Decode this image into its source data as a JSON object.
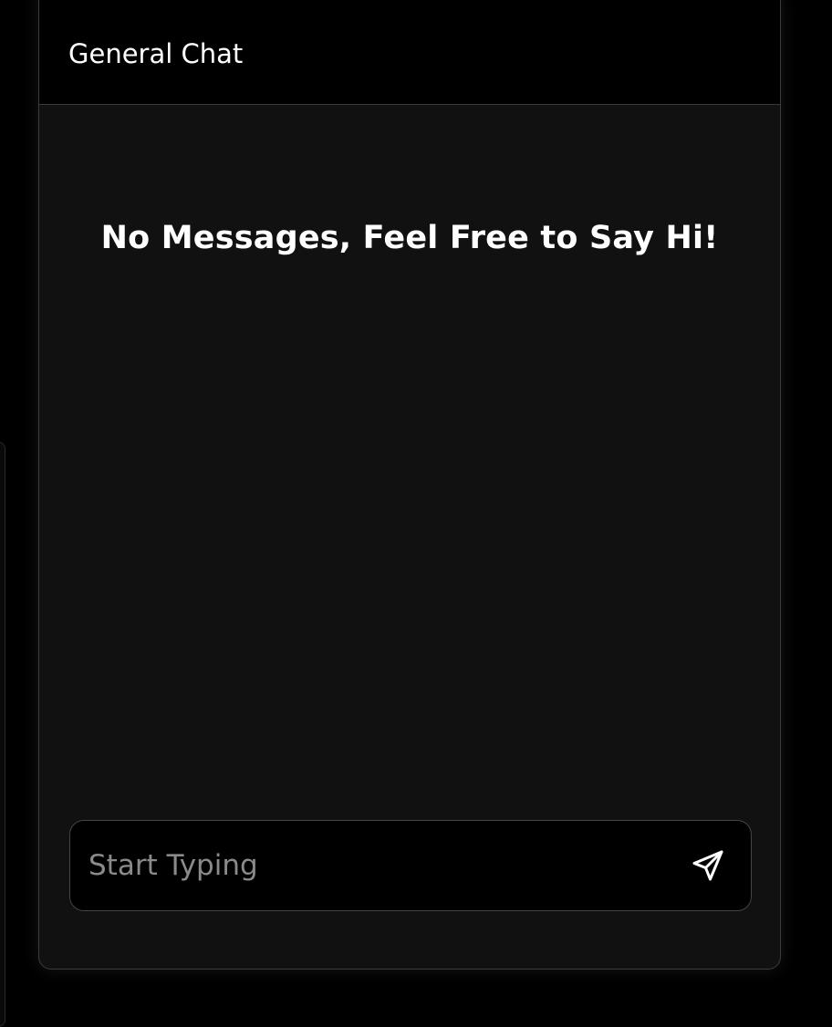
{
  "chat": {
    "title": "General Chat",
    "empty_state": "No Messages, Feel Free to Say Hi!"
  },
  "composer": {
    "placeholder": "Start Typing",
    "value": "",
    "send_icon": "send-icon"
  },
  "colors": {
    "background": "#000000",
    "panel": "#111111",
    "border": "#3c3c3c",
    "text": "#ffffff",
    "placeholder": "#8a8a8a"
  }
}
